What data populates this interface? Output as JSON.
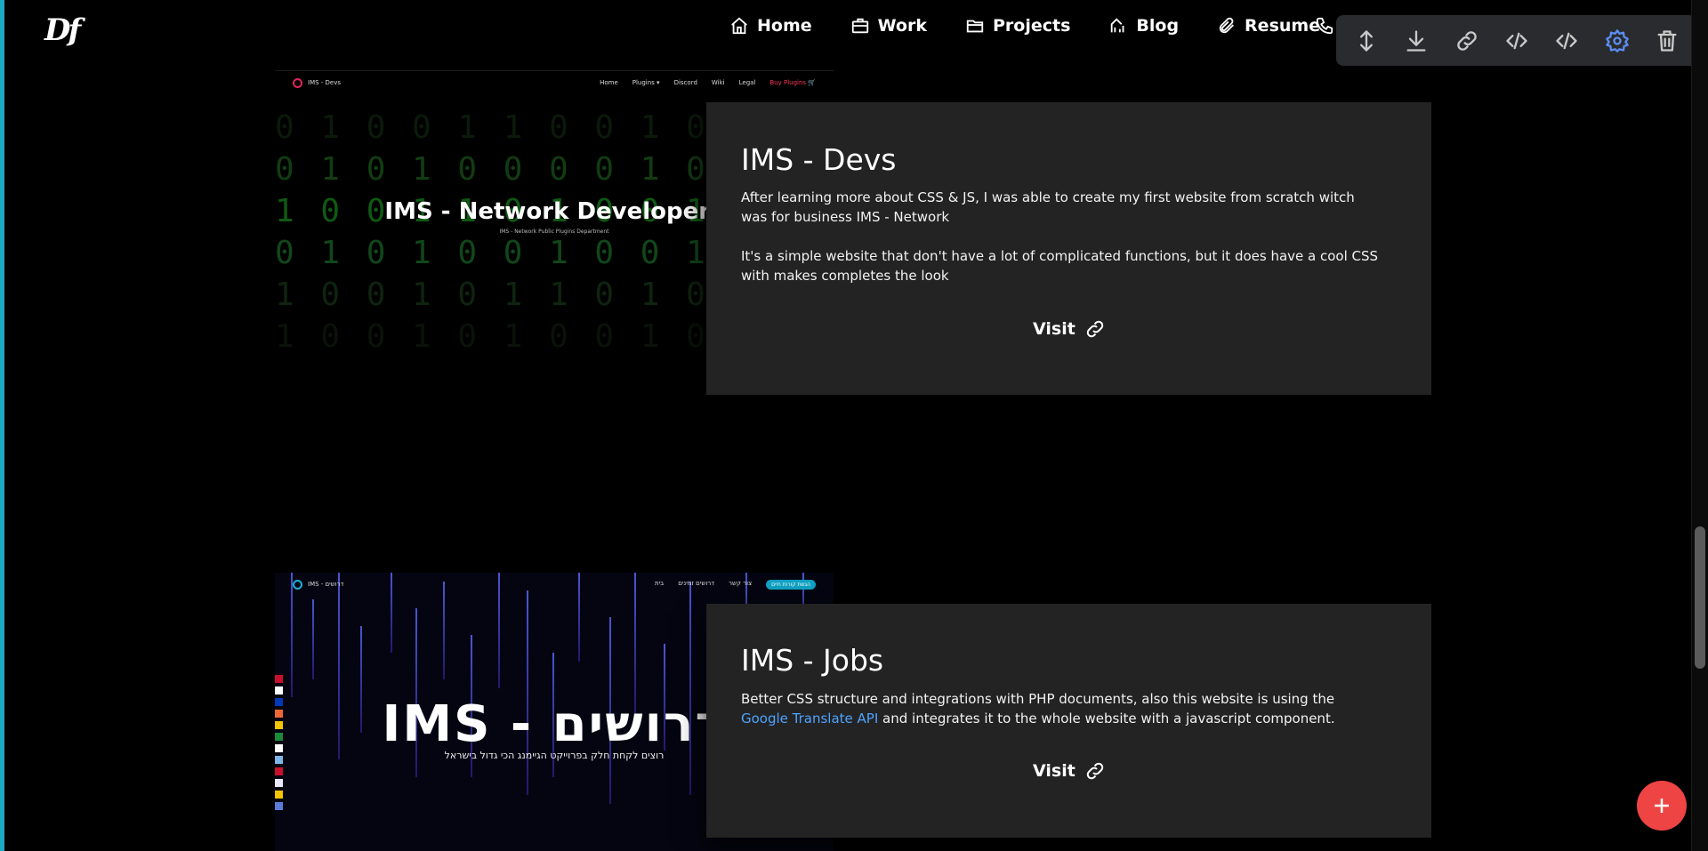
{
  "header": {
    "logo": "Df",
    "nav": [
      {
        "label": "Home",
        "icon": "home-icon"
      },
      {
        "label": "Work",
        "icon": "briefcase-icon"
      },
      {
        "label": "Projects",
        "icon": "folder-icon"
      },
      {
        "label": "Blog",
        "icon": "blog-icon"
      },
      {
        "label": "Resume",
        "icon": "paperclip-icon"
      }
    ],
    "contact_icon": "phone-icon"
  },
  "toolbar": {
    "tools": [
      {
        "icon": "resize-vertical-icon"
      },
      {
        "icon": "download-icon"
      },
      {
        "icon": "link-icon"
      },
      {
        "icon": "code-icon"
      },
      {
        "icon": "code-alt-icon"
      },
      {
        "icon": "gear-icon",
        "active": true
      },
      {
        "icon": "trash-icon"
      }
    ],
    "active_color": "#5b8def"
  },
  "projects": [
    {
      "title": "IMS - Devs",
      "paragraphs": [
        "After learning more about CSS & JS, I was able to create my first website from scratch witch was for business IMS - Network",
        "It's a simple website that don't have a lot of complicated functions, but it does have a cool CSS with makes completes the look"
      ],
      "visit_label": "Visit",
      "screenshot": {
        "brand": "IMS - Devs",
        "nav": [
          "Home",
          "Plugins ▾",
          "Discord",
          "Wiki",
          "Legal",
          "Buy Plugins 🛒"
        ],
        "hero_title": "IMS - Network Developers",
        "hero_subtitle": "IMS - Network Public Plugins Department"
      }
    },
    {
      "title": "IMS - Jobs",
      "text_before_link": "Better CSS structure and integrations with PHP documents, also this website is using the ",
      "link_text": "Google Translate API",
      "text_after_link": " and integrates it to the whole website with a javascript component.",
      "visit_label": "Visit",
      "screenshot": {
        "brand": "IMS - דרושים",
        "nav": [
          "בית",
          "דרושים זמינים",
          "צור קשר"
        ],
        "cta": "הגשת קורות חיים",
        "hero_title": "IMS - דרושים",
        "hero_subtitle": "רוצים לקחת חלק בפרוייקט הגיימנג הכי גדול בישראל"
      }
    }
  ],
  "colors": {
    "background": "#000000",
    "card": "#232323",
    "accent_left_border": "#1ea7c4",
    "link": "#4ea3ff",
    "fab": "#ef4444"
  },
  "fab_icon": "plus-icon"
}
